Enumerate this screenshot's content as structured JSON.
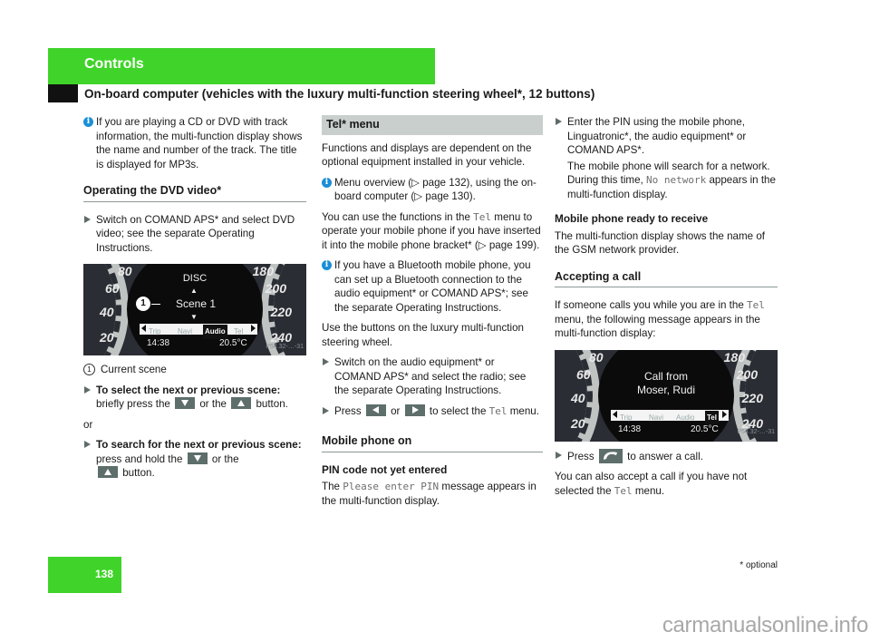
{
  "header": {
    "section": "Controls",
    "subtitle": "On-board computer (vehicles with the luxury multi-function steering wheel*, 12 buttons)"
  },
  "colors": {
    "band_green": "#40d42a",
    "info_blue": "#1a8fd6",
    "button_gray": "#5d6e6b",
    "section_head_gray": "#c8cfcc"
  },
  "col1": {
    "info_track": "If you are playing a CD or DVD with track information, the multi-function display shows the name and number of the track. The title is displayed for MP3s.",
    "dvd_heading": "Operating the DVD video*",
    "dvd_step": "Switch on COMAND APS* and select DVD video; see the separate Operating Instructions.",
    "display1": {
      "speeds_left": [
        "80",
        "60",
        "40",
        "20"
      ],
      "speeds_right": [
        "180",
        "200",
        "220",
        "240"
      ],
      "line1": "DISC",
      "line2": "Scene 1",
      "marker": "1",
      "menu": [
        "Trip",
        "Navi",
        "Audio",
        "Tel"
      ],
      "selected": "Audio",
      "time": "14:38",
      "temp": "20.5°C",
      "code": "P54.32-…-31"
    },
    "caption_num": "1",
    "caption": "Current scene",
    "step_select_bold": "To select the next or previous scene:",
    "step_select_a": "briefly press the",
    "or_the": "or the",
    "button_word": "button.",
    "or": "or",
    "step_search_bold": "To search for the next or previous scene:",
    "step_search_a": "press and hold the",
    "or_the2": "or the",
    "button_word2": "button."
  },
  "col2": {
    "tel_heading": "Tel* menu",
    "intro": "Functions and displays are dependent on the optional equipment installed in your vehicle.",
    "info_overview": "Menu overview (▷ page 132), using the on-board computer (▷ page 130).",
    "use_a": "You can use the functions in the",
    "tel": "Tel",
    "use_b": "menu to operate your mobile phone if you have inserted it into the mobile phone bracket* (▷ page 199).",
    "info_bt": "If you have a Bluetooth mobile phone, you can set up a Bluetooth connection to the audio equipment* or COMAND APS*; see the separate Operating Instructions.",
    "use_buttons": "Use the buttons on the luxury multi-function steering wheel.",
    "step_audio": "Switch on the audio equipment* or COMAND APS* and select the radio; see the separate Operating Instructions.",
    "press": "Press",
    "or": "or",
    "to_select": "to select the",
    "menu_word": "menu.",
    "mobile_heading": "Mobile phone on",
    "pin_heading": "PIN code not yet entered",
    "pin_a": "The",
    "pin_msg": "Please enter PIN",
    "pin_b": "message appears in the multi-function display."
  },
  "col3": {
    "enter_pin": "Enter the PIN using the mobile phone, Linguatronic*, the audio equipment* or COMAND APS*.",
    "search_a": "The mobile phone will search for a network. During this time,",
    "no_network": "No network",
    "search_b": "appears in the multi-function display.",
    "ready_heading": "Mobile phone ready to receive",
    "ready_text": "The multi-function display shows the name of the GSM network provider.",
    "accept_heading": "Accepting a call",
    "calls_a": "If someone calls you while you are in the",
    "tel": "Tel",
    "calls_b": "menu, the following message appears in the multi-function display:",
    "display2": {
      "speeds_left": [
        "80",
        "60",
        "40",
        "20"
      ],
      "speeds_right": [
        "180",
        "200",
        "220",
        "240"
      ],
      "line1": "Call from",
      "line2": "Moser, Rudi",
      "menu": [
        "Trip",
        "Navi",
        "Audio",
        "Tel"
      ],
      "selected": "Tel",
      "time": "14:38",
      "temp": "20.5°C",
      "code": "P54.32-…-31"
    },
    "press": "Press",
    "answer": "to answer a call.",
    "also_a": "You can also accept a call if you have not selected the",
    "menu_word": "menu."
  },
  "footer": {
    "page": "138",
    "optional": "* optional",
    "watermark": "carmanualsonline.info"
  }
}
